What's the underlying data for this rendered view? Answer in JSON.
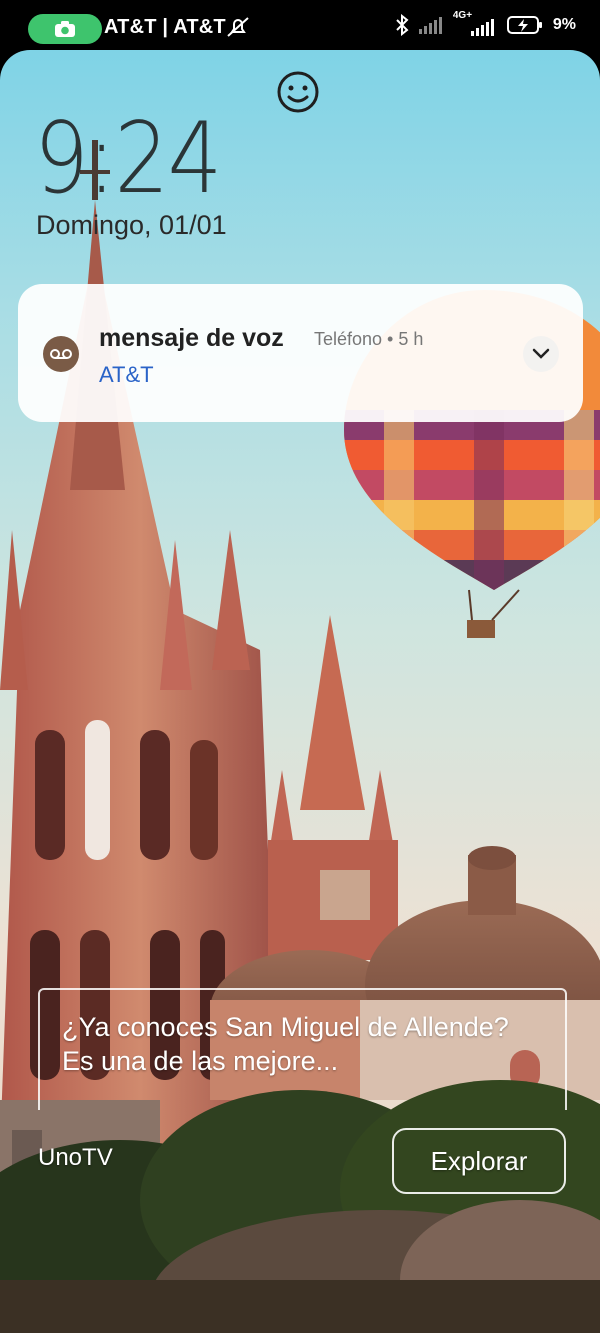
{
  "status_bar": {
    "carrier": "AT&T | AT&T",
    "battery": "9%",
    "network": "4G+"
  },
  "lock": {
    "time": "9:24",
    "date": "Domingo, 01/01"
  },
  "notification": {
    "title": "mensaje de voz",
    "app_meta": "Teléfono • 5 h",
    "body": "AT&T",
    "icon": "voicemail-icon"
  },
  "story": {
    "text": "¿Ya conoces San Miguel de Allende? Es una de las mejore...",
    "source": "UnoTV",
    "button": "Explorar"
  },
  "colors": {
    "record_pill": "#3ec46d",
    "notification_link": "#2a63c8",
    "voicemail_icon_bg": "#7a5b46"
  }
}
